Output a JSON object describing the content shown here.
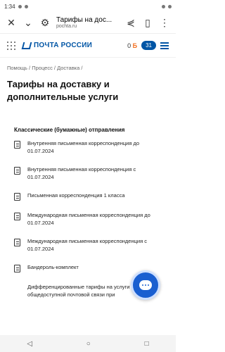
{
  "status": {
    "time": "1:34"
  },
  "browser": {
    "tab_title": "Тарифы на дос...",
    "host": "pochta.ru",
    "close_icon": "✕",
    "chevron_icon": "⌄",
    "share_icon": "⋞",
    "bookmark_icon": "▯",
    "more_icon": "⋮"
  },
  "header": {
    "logo_text": "ПОЧТА РОССИИ",
    "points_value": "0",
    "points_currency": "Б",
    "cart_count": "31"
  },
  "breadcrumb": "Помощь / Процесс / Доставка /",
  "page_title": "Тарифы на доставку и дополнительные услуги",
  "section_title": "Классические (бумажные) отправления",
  "documents": [
    "Внутренняя письменная корреспонденция до 01.07.2024",
    "Внутренняя письменная корреспонденция с 01.07.2024",
    "Письменная корреспонденция 1 класса",
    "Международная письменная корреспонденция до 01.07.2024",
    "Международная письменная корреспонденция с 01.07.2024",
    "Бандероль-комплект",
    "Дифференцированные тарифы на услуги общедоступной почтовой связи при"
  ],
  "nav": {
    "back": "◁",
    "home": "○",
    "recents": "□"
  },
  "colors": {
    "brand": "#0055a5",
    "fab": "#1a5fd0",
    "accent": "#f37021"
  }
}
